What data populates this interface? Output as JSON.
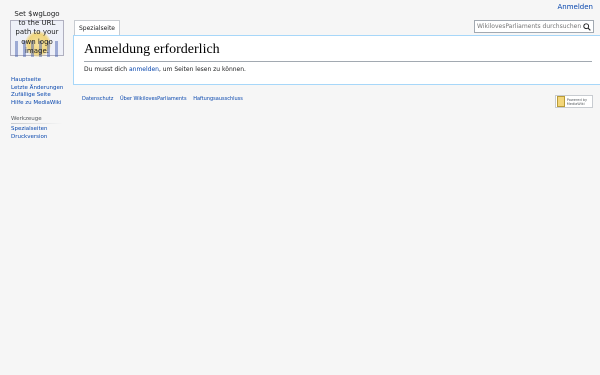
{
  "logo": {
    "lines": [
      "Set $wgLogo",
      "to the URL",
      "path to your",
      "own logo",
      "image."
    ]
  },
  "personal": {
    "login": "Anmelden"
  },
  "tabs": [
    {
      "label": "Spezialseite"
    }
  ],
  "search": {
    "placeholder": "WikilovesParliaments durchsuchen"
  },
  "page": {
    "title": "Anmeldung erforderlich",
    "text_before": "Du musst dich ",
    "link": "anmelden",
    "text_after": ", um Seiten lesen zu können."
  },
  "sidebar": {
    "navigation": [
      "Hauptseite",
      "Letzte Änderungen",
      "Zufällige Seite",
      "Hilfe zu MediaWiki"
    ],
    "tools_heading": "Werkzeuge",
    "tools": [
      "Spezialseiten",
      "Druckversion"
    ]
  },
  "footer": {
    "links": [
      "Datenschutz",
      "Über WikilovesParliaments",
      "Haftungsausschluss"
    ],
    "powered_by": "Powered by MediaWiki"
  }
}
